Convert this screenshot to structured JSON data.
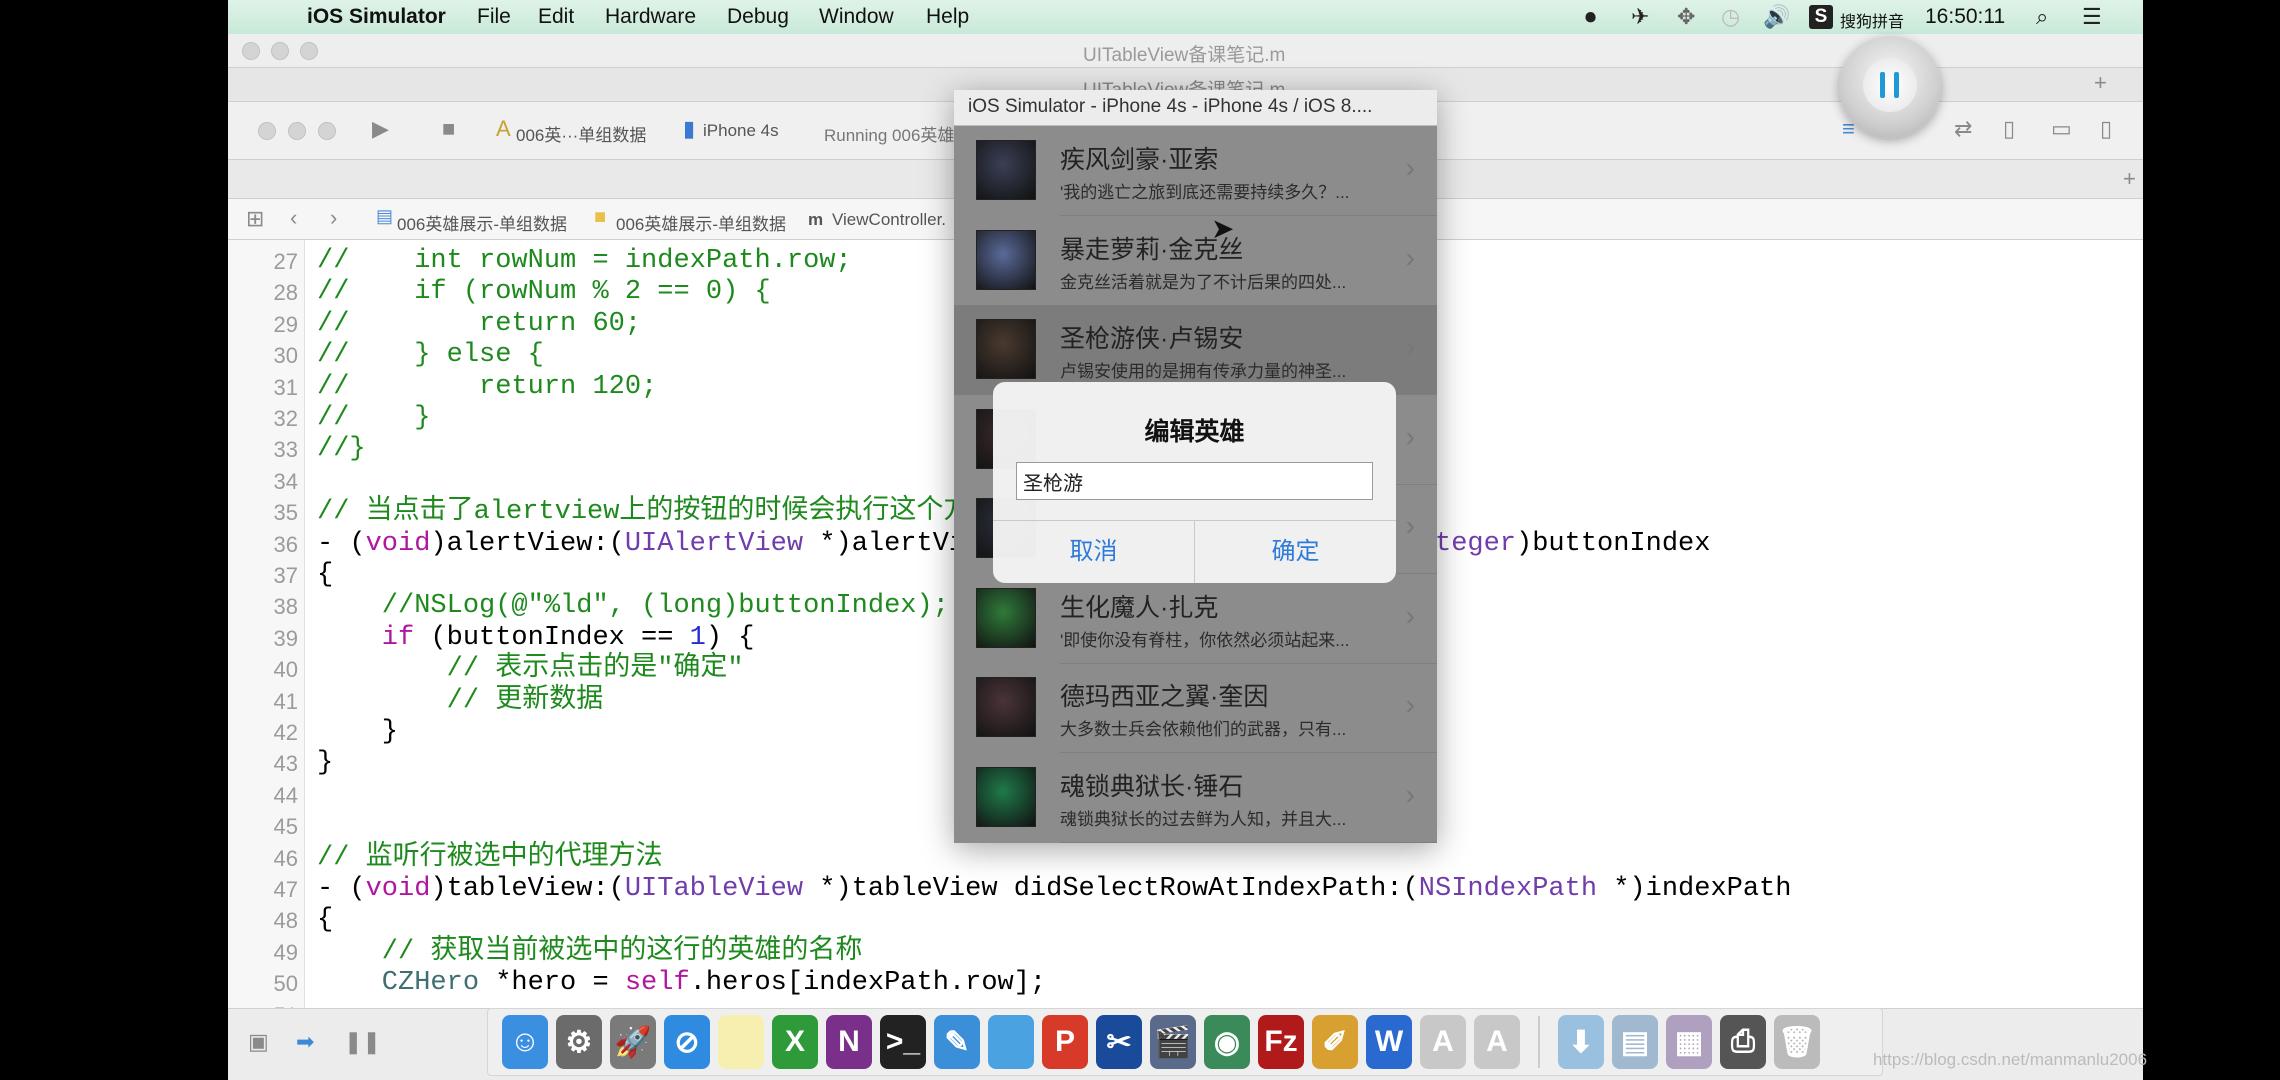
{
  "menubar": {
    "apple_icon": "apple-logo-icon",
    "app_name": "iOS Simulator",
    "items": [
      "File",
      "Edit",
      "Hardware",
      "Debug",
      "Window",
      "Help"
    ],
    "status_icons": [
      "screen-record-icon",
      "airplane-icon",
      "bluetooth-icon",
      "time-machine-icon",
      "volume-icon"
    ],
    "input_method_badge": "S",
    "input_method": "搜狗拼音",
    "clock": "16:50:11",
    "search_icon": "spotlight-search-icon",
    "list_icon": "notification-center-icon",
    "accent": "#d5eee0"
  },
  "xcode": {
    "window_title": "UITableView备课笔记.m",
    "tab_title": "UITableView备课笔记.m",
    "scheme": "006英···单组数据",
    "device": "iPhone 4s",
    "status": "Running 006英雄",
    "jumpbar": [
      "006英雄展示-单组数据",
      "006英雄展示-单组数据",
      "ViewController."
    ],
    "file_badge": "m",
    "plus": "+"
  },
  "code": [
    {
      "n": "27",
      "s": [
        [
          "c",
          "//    int rowNum = indexPath.row;"
        ]
      ]
    },
    {
      "n": "28",
      "s": [
        [
          "c",
          "//    if (rowNum % 2 == 0) {"
        ]
      ]
    },
    {
      "n": "29",
      "s": [
        [
          "c",
          "//        return 60;"
        ]
      ]
    },
    {
      "n": "30",
      "s": [
        [
          "c",
          "//    } else {"
        ]
      ]
    },
    {
      "n": "31",
      "s": [
        [
          "c",
          "//        return 120;"
        ]
      ]
    },
    {
      "n": "32",
      "s": [
        [
          "c",
          "//    }"
        ]
      ]
    },
    {
      "n": "33",
      "s": [
        [
          "c",
          "//}"
        ]
      ]
    },
    {
      "n": "34",
      "s": []
    },
    {
      "n": "35",
      "s": [
        [
          "c",
          "// 当点击了alertview上的按钮的时候会执行这个方法"
        ]
      ]
    },
    {
      "n": "36",
      "s": [
        [
          "p",
          "- ("
        ],
        [
          "k",
          "void"
        ],
        [
          "p",
          ")alertView:("
        ],
        [
          "t",
          "UIAlertView"
        ],
        [
          "p",
          " *)alertView clickedButtonAtIndex:("
        ],
        [
          "t",
          "NSInteger"
        ],
        [
          "p",
          ")buttonIndex"
        ]
      ]
    },
    {
      "n": "37",
      "s": [
        [
          "p",
          "{"
        ]
      ]
    },
    {
      "n": "38",
      "s": [
        [
          "c",
          "    //NSLog(@\"%ld\", (long)buttonIndex);"
        ]
      ]
    },
    {
      "n": "39",
      "s": [
        [
          "k",
          "    if"
        ],
        [
          "p",
          " (buttonIndex == "
        ],
        [
          "n",
          "1"
        ],
        [
          "p",
          ") {"
        ]
      ]
    },
    {
      "n": "40",
      "s": [
        [
          "c",
          "        // 表示点击的是\"确定\""
        ]
      ]
    },
    {
      "n": "41",
      "s": [
        [
          "c",
          "        // 更新数据"
        ]
      ]
    },
    {
      "n": "42",
      "s": [
        [
          "p",
          "    }"
        ]
      ]
    },
    {
      "n": "43",
      "s": [
        [
          "p",
          "}"
        ]
      ]
    },
    {
      "n": "44",
      "s": []
    },
    {
      "n": "45",
      "s": []
    },
    {
      "n": "46",
      "s": [
        [
          "c",
          "// 监听行被选中的代理方法"
        ]
      ]
    },
    {
      "n": "47",
      "s": [
        [
          "p",
          "- ("
        ],
        [
          "k",
          "void"
        ],
        [
          "p",
          ")tableView:("
        ],
        [
          "t",
          "UITableView"
        ],
        [
          "p",
          " *)tableView didSelectRowAtIndexPath:("
        ],
        [
          "t",
          "NSIndexPath"
        ],
        [
          "p",
          " *)indexPath"
        ]
      ]
    },
    {
      "n": "48",
      "s": [
        [
          "p",
          "{"
        ]
      ]
    },
    {
      "n": "49",
      "s": [
        [
          "c",
          "    // 获取当前被选中的这行的英雄的名称"
        ]
      ]
    },
    {
      "n": "50",
      "s": [
        [
          "cls",
          "    CZHero"
        ],
        [
          "p",
          " *hero = "
        ],
        [
          "k",
          "self"
        ],
        [
          "p",
          ".heros[indexPath.row];"
        ]
      ]
    },
    {
      "n": "51",
      "s": []
    }
  ],
  "simulator": {
    "title": "iOS Simulator - iPhone 4s - iPhone 4s / iOS 8....",
    "rows": [
      {
        "title": "疾风剑豪·亚索",
        "subtitle": "'我的逃亡之旅到底还需要持续多久？...",
        "color": "#3a3f55"
      },
      {
        "title": "暴走萝莉·金克丝",
        "subtitle": "金克丝活着就是为了不计后果的四处...",
        "color": "#5a6a9a"
      },
      {
        "title": "圣枪游侠·卢锡安",
        "subtitle": "卢锡安使用的是拥有传承力量的神圣...",
        "color": "#4a3a30",
        "selected": true
      },
      {
        "title": "",
        "subtitle": "",
        "color": "#3a2a2a"
      },
      {
        "title": "",
        "subtitle": "",
        "color": "#2a2f3a"
      },
      {
        "title": "生化魔人·扎克",
        "subtitle": "'即使你没有脊柱，你依然必须站起来...",
        "color": "#2f7a3a"
      },
      {
        "title": "德玛西亚之翼·奎因",
        "subtitle": "大多数士兵会依赖他们的武器，只有...",
        "color": "#4a3438"
      },
      {
        "title": "魂锁典狱长·锤石",
        "subtitle": "魂锁典狱长的过去鲜为人知，并且大...",
        "color": "#1f7a4a"
      }
    ],
    "alert": {
      "title": "编辑英雄",
      "input_value": "圣枪游",
      "cancel": "取消",
      "confirm": "确定",
      "button_color": "#2f7bd9"
    }
  },
  "dock": [
    {
      "icon": "finder-icon",
      "g": "☺",
      "bg": "#3b8fe0"
    },
    {
      "icon": "system-preferences-icon",
      "g": "⚙",
      "bg": "#6b6b6b"
    },
    {
      "icon": "launchpad-icon",
      "g": "🚀",
      "bg": "#7a7a7a"
    },
    {
      "icon": "safari-icon",
      "g": "⊘",
      "bg": "#2f8be0"
    },
    {
      "icon": "notes-icon",
      "g": "",
      "bg": "#f6efb0"
    },
    {
      "icon": "excel-icon",
      "g": "X",
      "bg": "#2e9a3a"
    },
    {
      "icon": "onenote-icon",
      "g": "N",
      "bg": "#7a2f8a"
    },
    {
      "icon": "terminal-icon",
      "g": ">_",
      "bg": "#222"
    },
    {
      "icon": "xcode-icon",
      "g": "✎",
      "bg": "#3a8fd8"
    },
    {
      "icon": "folder-icon",
      "g": "",
      "bg": "#4aa3e0"
    },
    {
      "icon": "powerpoint-icon",
      "g": "P",
      "bg": "#d83a2a"
    },
    {
      "icon": "screenshot-icon",
      "g": "✂",
      "bg": "#1a4a9a"
    },
    {
      "icon": "video-editor-icon",
      "g": "🎬",
      "bg": "#5a6a8a"
    },
    {
      "icon": "network-icon",
      "g": "◉",
      "bg": "#3a8a5a"
    },
    {
      "icon": "filezilla-icon",
      "g": "Fz",
      "bg": "#b01a1a"
    },
    {
      "icon": "sketch-icon",
      "g": "✐",
      "bg": "#d8a030"
    },
    {
      "icon": "word-icon",
      "g": "W",
      "bg": "#2a6ad0"
    },
    {
      "icon": "instruments-icon",
      "g": "A",
      "bg": "#c8c8c8"
    },
    {
      "icon": "instruments-icon-2",
      "g": "A",
      "bg": "#c8c8c8"
    },
    {
      "sep": true
    },
    {
      "icon": "downloads-stack-icon",
      "g": "⬇",
      "bg": "#9ac0e0"
    },
    {
      "icon": "documents-stack-icon",
      "g": "▤",
      "bg": "#a0b8d0"
    },
    {
      "icon": "preview-stack-icon",
      "g": "▦",
      "bg": "#b0a0c0"
    },
    {
      "icon": "printer-icon",
      "g": "⎙",
      "bg": "#555"
    },
    {
      "icon": "trash-icon",
      "g": "🗑",
      "bg": "#bbb"
    }
  ],
  "watermark": "https://blog.csdn.net/manmanlu2006"
}
